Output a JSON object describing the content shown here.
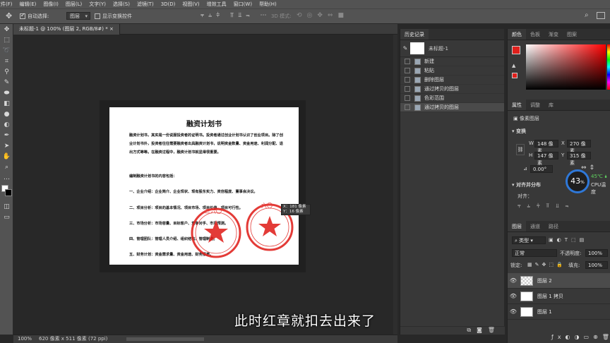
{
  "menu": [
    "文件(F)",
    "编辑(E)",
    "图像(I)",
    "图层(L)",
    "文字(Y)",
    "选择(S)",
    "滤镜(T)",
    "3D(D)",
    "视图(V)",
    "增效工具",
    "窗口(W)",
    "帮助(H)"
  ],
  "options": {
    "auto_select_label": "自动选择:",
    "auto_select_value": "图层",
    "show_transform_label": "显示变换控件",
    "mode_3d_label": "3D 模式:"
  },
  "document": {
    "tab_title": "未标题-1 @ 100% (图层 2, RGB/8#) *",
    "zoom": "100%",
    "size_info": "620 像素 x 511 像素 (72 ppi)",
    "heading": "融资计划书",
    "para1": "融资计划书，其实是一份说服投资者的证明书。投资者通过创业计划书认识了创业项目。除了创业计划书外，投资者往往需要融资者出具融资计划书，说明资金数量、资金用途、利润分配、退出方式等等。在融资过程中，融资计划书就显得很重要。",
    "para2": "编制融资计划书的内容包括：",
    "item1": "一、企业介绍：企业简介、企业现状、现有股东实力、资信程度、董事会决议。",
    "item2": "二、项目分析：项目的基本情况、项目市场、项目价值、项目可行性。",
    "item3": "三、市场分析：市场容量、目标客户、竞争对手、市场预测。",
    "item4": "四、管理团队：管理人员介绍、组织结构、管理制度。",
    "item5": "五、财务计划：资金需求量、资金用途、财务报表。",
    "cursor_x": "X：181 像素",
    "cursor_y": "Y：16 像素",
    "seal_text_left": "三六〇",
    "seal_text_right": "六〇"
  },
  "subtitle": "此时红章就扣去出来了",
  "history": {
    "tabs": [
      "历史记录"
    ],
    "snapshot": "未标题-1",
    "items": [
      "新建",
      "粘贴",
      "删除图层",
      "通过拷贝的图层",
      "色彩范围",
      "通过拷贝的图层"
    ],
    "selected_index": 5
  },
  "color_panel": {
    "tabs": [
      "颜色",
      "色板",
      "渐变",
      "图案"
    ],
    "foreground": "#e0201c",
    "background": "#ffffff",
    "hue_color": "#ff0000"
  },
  "properties": {
    "tabs": [
      "属性",
      "调整",
      "库"
    ],
    "kind": "像素图层",
    "transform_label": "变换",
    "w": "148 像素",
    "h": "147 像素",
    "x": "270 像素",
    "y": "315 像素",
    "angle": "0.00°",
    "align_label": "对齐并分布",
    "align_sub": "对齐："
  },
  "cpu_widget": {
    "percent": "43",
    "percent_sign": "%",
    "temp": "45℃",
    "label": "CPU温度",
    "ring_color": "#2f78d8"
  },
  "layers": {
    "tabs": [
      "图层",
      "通道",
      "路径"
    ],
    "filter": "类型",
    "blend": "正常",
    "opacity_label": "不透明度:",
    "opacity": "100%",
    "lock_label": "锁定:",
    "fill_label": "填充:",
    "fill": "100%",
    "items": [
      "图层 2",
      "图层 1 拷贝",
      "图层 1"
    ],
    "selected_index": 0
  }
}
